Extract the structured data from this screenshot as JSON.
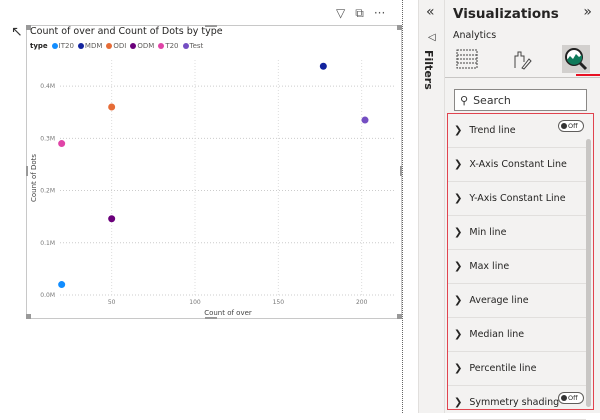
{
  "visual": {
    "header_icons": [
      "filter-icon",
      "focus-mode-icon",
      "more-options-icon"
    ]
  },
  "chart_data": {
    "type": "scatter",
    "title": "Count of over and Count of Dots by type",
    "legend_title": "type",
    "legend_placement": "top-left",
    "xlabel": "Count of over",
    "ylabel": "Count of Dots",
    "xlim": [
      19,
      220
    ],
    "ylim": [
      0,
      0.45
    ],
    "x_ticks": [
      50,
      100,
      150,
      200
    ],
    "y_ticks": [
      {
        "v": 0,
        "label": "0.0M"
      },
      {
        "v": 0.1,
        "label": "0.1M"
      },
      {
        "v": 0.2,
        "label": "0.2M"
      },
      {
        "v": 0.3,
        "label": "0.3M"
      },
      {
        "v": 0.4,
        "label": "0.4M"
      }
    ],
    "grid": true,
    "series": [
      {
        "name": "IT20",
        "color": "#118dff",
        "x": 20,
        "y": 0.02
      },
      {
        "name": "MDM",
        "color": "#12239e",
        "x": 177,
        "y": 0.438
      },
      {
        "name": "ODI",
        "color": "#e66c37",
        "x": 50,
        "y": 0.36
      },
      {
        "name": "ODM",
        "color": "#6b007b",
        "x": 50,
        "y": 0.146
      },
      {
        "name": "T20",
        "color": "#e044a7",
        "x": 20,
        "y": 0.29
      },
      {
        "name": "Test",
        "color": "#744ec2",
        "x": 202,
        "y": 0.335
      }
    ]
  },
  "filters": {
    "label": "Filters"
  },
  "viz": {
    "title": "Visualizations",
    "subtitle": "Analytics",
    "tabs": [
      "build-visual",
      "format-visual",
      "analytics"
    ],
    "search_placeholder": "Search",
    "accent": "#e81123",
    "items": [
      {
        "label": "Trend line",
        "toggle": "Off"
      },
      {
        "label": "X-Axis Constant Line"
      },
      {
        "label": "Y-Axis Constant Line"
      },
      {
        "label": "Min line"
      },
      {
        "label": "Max line"
      },
      {
        "label": "Average line"
      },
      {
        "label": "Median line"
      },
      {
        "label": "Percentile line"
      },
      {
        "label": "Symmetry shading",
        "toggle": "Off"
      }
    ]
  }
}
